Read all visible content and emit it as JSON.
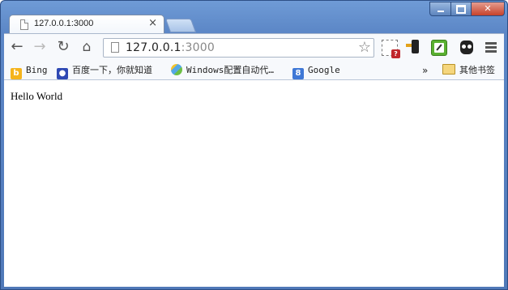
{
  "window": {
    "minimize_icon": "minimize-icon",
    "maximize_icon": "maximize-icon",
    "close_icon": "close-icon",
    "close_glyph": "✕"
  },
  "tabs": [
    {
      "title": "127.0.0.1:3000",
      "icon": "page-icon",
      "close": "×",
      "active": true
    }
  ],
  "toolbar": {
    "back_glyph": "←",
    "forward_glyph": "→",
    "reload_glyph": "↻",
    "home_glyph": "⌂",
    "url_host": "127.0.0.1",
    "url_port": ":3000",
    "star_glyph": "☆",
    "extensions": [
      "qr-code-extension-icon",
      "phone-push-extension-icon",
      "evernote-clip-extension-icon",
      "owl-extension-icon"
    ],
    "menu_icon": "menu-icon"
  },
  "bookmarks": {
    "items": [
      {
        "label": "Bing",
        "icon": "bing-icon",
        "glyph": "b"
      },
      {
        "label": "百度一下，你就知道",
        "icon": "baidu-paw-icon",
        "glyph": "🐾"
      },
      {
        "label": "Windows配置自动代…",
        "icon": "windows-pinwheel-icon",
        "glyph": ""
      },
      {
        "label": "Google",
        "icon": "google-icon",
        "glyph": "8"
      }
    ],
    "more": "»",
    "other_folder": "其他书签"
  },
  "page": {
    "body_text": "Hello World"
  },
  "colors": {
    "frame": "#5b86c6",
    "toolbar_bg": "#f7f9fc",
    "close_red": "#c6412a"
  }
}
